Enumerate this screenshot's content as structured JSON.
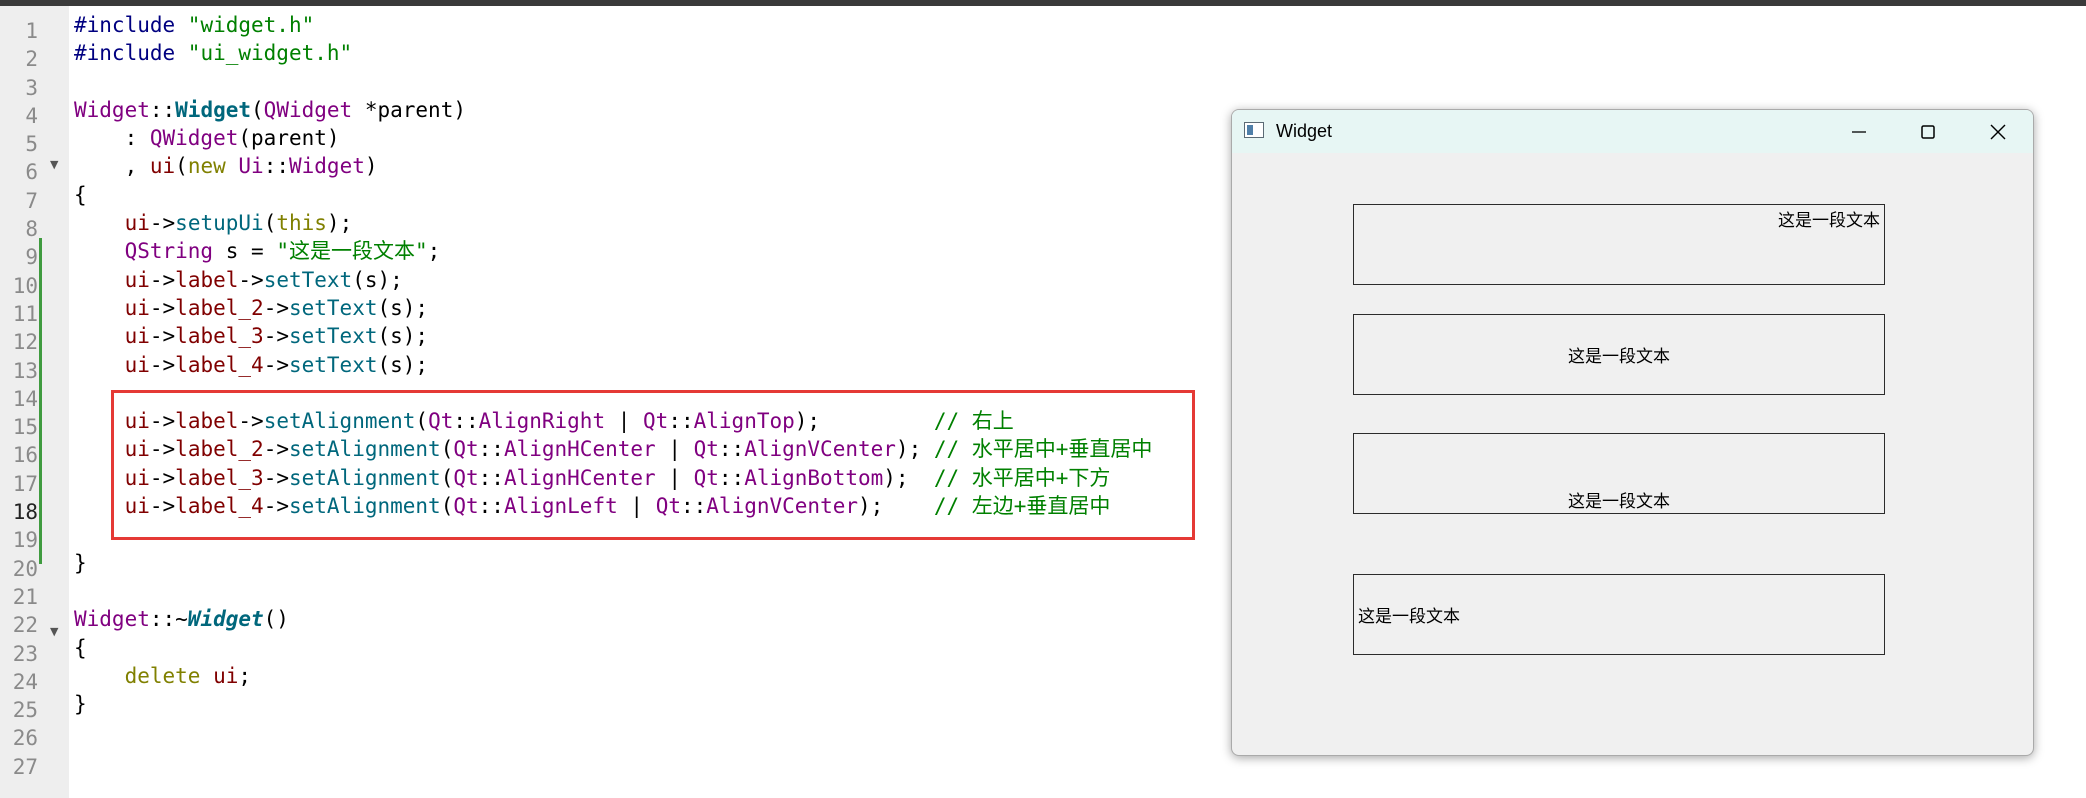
{
  "editor": {
    "line_numbers": [
      "1",
      "2",
      "3",
      "4",
      "5",
      "6",
      "7",
      "8",
      "9",
      "10",
      "11",
      "12",
      "13",
      "14",
      "15",
      "16",
      "17",
      "18",
      "19",
      "20",
      "21",
      "22",
      "23",
      "24",
      "25",
      "26",
      "27"
    ],
    "current_line": "18",
    "lines": [
      [
        {
          "t": "#include ",
          "c": "pre"
        },
        {
          "t": "\"widget.h\"",
          "c": "str"
        }
      ],
      [
        {
          "t": "#include ",
          "c": "pre"
        },
        {
          "t": "\"ui_widget.h\"",
          "c": "str"
        }
      ],
      [],
      [
        {
          "t": "Widget",
          "c": "type"
        },
        {
          "t": "::",
          "c": "op"
        },
        {
          "t": "Widget",
          "c": "func bold"
        },
        {
          "t": "(",
          "c": "op"
        },
        {
          "t": "QWidget",
          "c": "type"
        },
        {
          "t": " *",
          "c": "op"
        },
        {
          "t": "parent",
          "c": "op"
        },
        {
          "t": ")",
          "c": "op"
        }
      ],
      [
        {
          "t": "    : ",
          "c": "op"
        },
        {
          "t": "QWidget",
          "c": "type"
        },
        {
          "t": "(",
          "c": "op"
        },
        {
          "t": "parent",
          "c": "op"
        },
        {
          "t": ")",
          "c": "op"
        }
      ],
      [
        {
          "t": "    , ",
          "c": "op"
        },
        {
          "t": "ui",
          "c": "id"
        },
        {
          "t": "(",
          "c": "op"
        },
        {
          "t": "new",
          "c": "kw"
        },
        {
          "t": " ",
          "c": "op"
        },
        {
          "t": "Ui",
          "c": "type"
        },
        {
          "t": "::",
          "c": "op"
        },
        {
          "t": "Widget",
          "c": "type"
        },
        {
          "t": ")",
          "c": "op"
        }
      ],
      [
        {
          "t": "{",
          "c": "op"
        }
      ],
      [
        {
          "t": "    ",
          "c": "op"
        },
        {
          "t": "ui",
          "c": "id"
        },
        {
          "t": "->",
          "c": "op"
        },
        {
          "t": "setupUi",
          "c": "func"
        },
        {
          "t": "(",
          "c": "op"
        },
        {
          "t": "this",
          "c": "kw"
        },
        {
          "t": ");",
          "c": "op"
        }
      ],
      [
        {
          "t": "    ",
          "c": "op"
        },
        {
          "t": "QString",
          "c": "type"
        },
        {
          "t": " s = ",
          "c": "op"
        },
        {
          "t": "\"这是一段文本\"",
          "c": "str"
        },
        {
          "t": ";",
          "c": "op"
        }
      ],
      [
        {
          "t": "    ",
          "c": "op"
        },
        {
          "t": "ui",
          "c": "id"
        },
        {
          "t": "->",
          "c": "op"
        },
        {
          "t": "label",
          "c": "id"
        },
        {
          "t": "->",
          "c": "op"
        },
        {
          "t": "setText",
          "c": "func"
        },
        {
          "t": "(s);",
          "c": "op"
        }
      ],
      [
        {
          "t": "    ",
          "c": "op"
        },
        {
          "t": "ui",
          "c": "id"
        },
        {
          "t": "->",
          "c": "op"
        },
        {
          "t": "label_2",
          "c": "id"
        },
        {
          "t": "->",
          "c": "op"
        },
        {
          "t": "setText",
          "c": "func"
        },
        {
          "t": "(s);",
          "c": "op"
        }
      ],
      [
        {
          "t": "    ",
          "c": "op"
        },
        {
          "t": "ui",
          "c": "id"
        },
        {
          "t": "->",
          "c": "op"
        },
        {
          "t": "label_3",
          "c": "id"
        },
        {
          "t": "->",
          "c": "op"
        },
        {
          "t": "setText",
          "c": "func"
        },
        {
          "t": "(s);",
          "c": "op"
        }
      ],
      [
        {
          "t": "    ",
          "c": "op"
        },
        {
          "t": "ui",
          "c": "id"
        },
        {
          "t": "->",
          "c": "op"
        },
        {
          "t": "label_4",
          "c": "id"
        },
        {
          "t": "->",
          "c": "op"
        },
        {
          "t": "setText",
          "c": "func"
        },
        {
          "t": "(s);",
          "c": "op"
        }
      ],
      [],
      [
        {
          "t": "    ",
          "c": "op"
        },
        {
          "t": "ui",
          "c": "id"
        },
        {
          "t": "->",
          "c": "op"
        },
        {
          "t": "label",
          "c": "id"
        },
        {
          "t": "->",
          "c": "op"
        },
        {
          "t": "setAlignment",
          "c": "func"
        },
        {
          "t": "(",
          "c": "op"
        },
        {
          "t": "Qt",
          "c": "type"
        },
        {
          "t": "::",
          "c": "op"
        },
        {
          "t": "AlignRight",
          "c": "type"
        },
        {
          "t": " | ",
          "c": "op"
        },
        {
          "t": "Qt",
          "c": "type"
        },
        {
          "t": "::",
          "c": "op"
        },
        {
          "t": "AlignTop",
          "c": "type"
        },
        {
          "t": ");         ",
          "c": "op"
        },
        {
          "t": "// 右上",
          "c": "cmt"
        }
      ],
      [
        {
          "t": "    ",
          "c": "op"
        },
        {
          "t": "ui",
          "c": "id"
        },
        {
          "t": "->",
          "c": "op"
        },
        {
          "t": "label_2",
          "c": "id"
        },
        {
          "t": "->",
          "c": "op"
        },
        {
          "t": "setAlignment",
          "c": "func"
        },
        {
          "t": "(",
          "c": "op"
        },
        {
          "t": "Qt",
          "c": "type"
        },
        {
          "t": "::",
          "c": "op"
        },
        {
          "t": "AlignHCenter",
          "c": "type"
        },
        {
          "t": " | ",
          "c": "op"
        },
        {
          "t": "Qt",
          "c": "type"
        },
        {
          "t": "::",
          "c": "op"
        },
        {
          "t": "AlignVCenter",
          "c": "type"
        },
        {
          "t": "); ",
          "c": "op"
        },
        {
          "t": "// 水平居中+垂直居中",
          "c": "cmt"
        }
      ],
      [
        {
          "t": "    ",
          "c": "op"
        },
        {
          "t": "ui",
          "c": "id"
        },
        {
          "t": "->",
          "c": "op"
        },
        {
          "t": "label_3",
          "c": "id"
        },
        {
          "t": "->",
          "c": "op"
        },
        {
          "t": "setAlignment",
          "c": "func"
        },
        {
          "t": "(",
          "c": "op"
        },
        {
          "t": "Qt",
          "c": "type"
        },
        {
          "t": "::",
          "c": "op"
        },
        {
          "t": "AlignHCenter",
          "c": "type"
        },
        {
          "t": " | ",
          "c": "op"
        },
        {
          "t": "Qt",
          "c": "type"
        },
        {
          "t": "::",
          "c": "op"
        },
        {
          "t": "AlignBottom",
          "c": "type"
        },
        {
          "t": ");  ",
          "c": "op"
        },
        {
          "t": "// 水平居中+下方",
          "c": "cmt"
        }
      ],
      [
        {
          "t": "    ",
          "c": "op"
        },
        {
          "t": "ui",
          "c": "id"
        },
        {
          "t": "->",
          "c": "op"
        },
        {
          "t": "label_4",
          "c": "id"
        },
        {
          "t": "->",
          "c": "op"
        },
        {
          "t": "setAlignment",
          "c": "func"
        },
        {
          "t": "(",
          "c": "op"
        },
        {
          "t": "Qt",
          "c": "type"
        },
        {
          "t": "::",
          "c": "op"
        },
        {
          "t": "AlignLeft",
          "c": "type"
        },
        {
          "t": " | ",
          "c": "op"
        },
        {
          "t": "Qt",
          "c": "type"
        },
        {
          "t": "::",
          "c": "op"
        },
        {
          "t": "AlignVCenter",
          "c": "type"
        },
        {
          "t": ");    ",
          "c": "op"
        },
        {
          "t": "// 左边+垂直居中",
          "c": "cmt"
        }
      ],
      [],
      [
        {
          "t": "}",
          "c": "op"
        }
      ],
      [],
      [
        {
          "t": "Widget",
          "c": "type"
        },
        {
          "t": "::~",
          "c": "op"
        },
        {
          "t": "Widget",
          "c": "func boldit"
        },
        {
          "t": "()",
          "c": "op"
        }
      ],
      [
        {
          "t": "{",
          "c": "op"
        }
      ],
      [
        {
          "t": "    ",
          "c": "op"
        },
        {
          "t": "delete",
          "c": "kw"
        },
        {
          "t": " ",
          "c": "op"
        },
        {
          "t": "ui",
          "c": "id"
        },
        {
          "t": ";",
          "c": "op"
        }
      ],
      [
        {
          "t": "}",
          "c": "op"
        }
      ],
      [],
      []
    ]
  },
  "window": {
    "title": "Widget",
    "minimize_glyph": "—",
    "maximize_glyph": "☐",
    "close_glyph": "✕",
    "labels": [
      {
        "text": "这是一段文本",
        "align": "right-top"
      },
      {
        "text": "这是一段文本",
        "align": "hcenter-vcenter"
      },
      {
        "text": "这是一段文本",
        "align": "hcenter-bottom"
      },
      {
        "text": "这是一段文本",
        "align": "left-vcenter"
      }
    ]
  },
  "colors": {
    "highlight_box": "#e53935",
    "titlebar": "#e7f6f4",
    "window_bg": "#f0f0f0"
  }
}
